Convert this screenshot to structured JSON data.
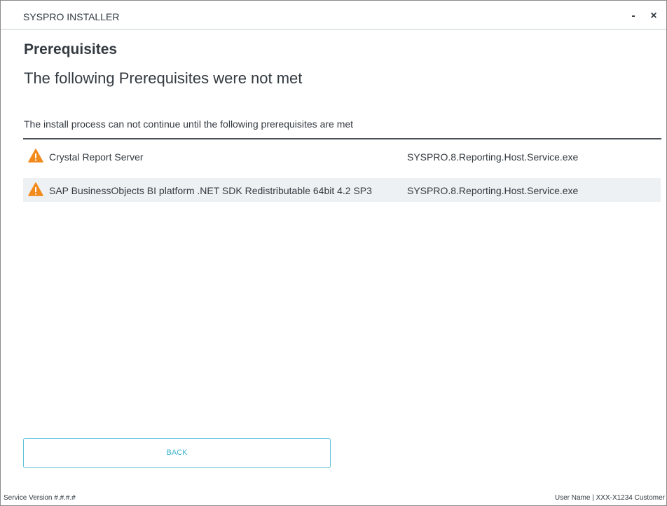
{
  "window": {
    "title": "SYSPRO INSTALLER",
    "minimize_label": "-",
    "close_label": "×"
  },
  "page": {
    "title": "Prerequisites",
    "subtitle": "The following Prerequisites were not met"
  },
  "section": {
    "header": "The install process can not continue until the following prerequisites are met"
  },
  "prerequisites": [
    {
      "name": "Crystal Report Server",
      "executable": "SYSPRO.8.Reporting.Host.Service.exe",
      "icon": "warning-icon"
    },
    {
      "name": "SAP BusinessObjects BI platform .NET SDK Redistributable 64bit 4.2 SP3",
      "executable": "SYSPRO.8.Reporting.Host.Service.exe",
      "icon": "warning-icon"
    }
  ],
  "buttons": {
    "back_label": "BACK"
  },
  "footer": {
    "service_version": "Service Version #.#.#.#",
    "user_info": "User Name | XXX-X1234 Customer"
  },
  "colors": {
    "warning": "#f28a1c",
    "accent": "#3fb4cc",
    "text": "#333a40",
    "row_alt": "#eef1f4"
  }
}
